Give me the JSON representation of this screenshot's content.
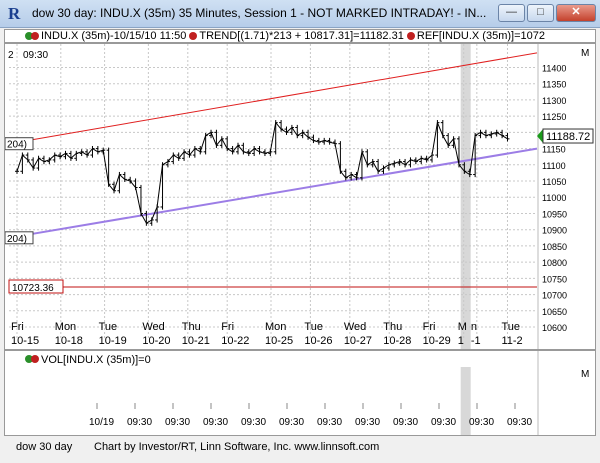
{
  "window": {
    "title": "dow 30 day: INDU.X (35m) 35 Minutes, Session 1 - NOT MARKED INTRADAY! - IN...",
    "minimize_label": "—",
    "maximize_label": "□",
    "close_label": "✕"
  },
  "legend": {
    "symbol": "INDU.X (35m)-10/15/10 11:50",
    "trend": "TREND[(1.71)*213 + 10817.31]=11182.31",
    "ref": "REF[INDU.X (35m)]=1072"
  },
  "top_pane": {
    "corner_number": "2",
    "corner_time": "09:30",
    "right_marker": "M",
    "price_tag": "11188.72",
    "trend_left_tag": "204)",
    "lower_left_tag": "204)",
    "ref_tag": "10723.36",
    "colors": {
      "trend_upper": "#e02020",
      "trend_lower": "#9c7de6",
      "ref": "#c01010",
      "price": "#000000",
      "highlight": "#d8d8d8"
    }
  },
  "chart_data": {
    "type": "line",
    "title": "",
    "ylim": [
      10560,
      11460
    ],
    "yticks": [
      11400,
      11350,
      11300,
      11250,
      11200,
      11150,
      11100,
      11050,
      11000,
      10950,
      10900,
      10850,
      10800,
      10750,
      10700,
      10650,
      10600
    ],
    "price_tag_value": 11188.72,
    "ref_value": 10723.36,
    "upper_trend": [
      [
        0,
        11165
      ],
      [
        100,
        11445
      ]
    ],
    "lower_trend": [
      [
        0,
        10875
      ],
      [
        100,
        11150
      ]
    ],
    "series": [
      {
        "values": [
          [
            0,
            11080
          ],
          [
            1,
            11130
          ],
          [
            2,
            11115
          ],
          [
            3,
            11090
          ],
          [
            4,
            11120
          ],
          [
            5,
            11110
          ],
          [
            6,
            11115
          ],
          [
            7,
            11130
          ],
          [
            8,
            11125
          ],
          [
            9,
            11135
          ],
          [
            10,
            11120
          ],
          [
            11,
            11135
          ],
          [
            12,
            11140
          ],
          [
            13,
            11130
          ],
          [
            14,
            11150
          ],
          [
            15,
            11140
          ],
          [
            16,
            11145
          ],
          [
            17,
            11040
          ],
          [
            18,
            11020
          ],
          [
            19,
            11070
          ],
          [
            20,
            11055
          ],
          [
            21,
            11050
          ],
          [
            22,
            11030
          ],
          [
            23,
            10950
          ],
          [
            24,
            10920
          ],
          [
            25,
            10930
          ],
          [
            26,
            10970
          ],
          [
            27,
            11100
          ],
          [
            28,
            11110
          ],
          [
            29,
            11130
          ],
          [
            30,
            11120
          ],
          [
            31,
            11140
          ],
          [
            32,
            11130
          ],
          [
            33,
            11150
          ],
          [
            34,
            11140
          ],
          [
            35,
            11190
          ],
          [
            36,
            11200
          ],
          [
            37,
            11160
          ],
          [
            38,
            11180
          ],
          [
            39,
            11150
          ],
          [
            40,
            11140
          ],
          [
            41,
            11160
          ],
          [
            42,
            11140
          ],
          [
            43,
            11135
          ],
          [
            44,
            11150
          ],
          [
            45,
            11140
          ],
          [
            46,
            11135
          ],
          [
            47,
            11140
          ],
          [
            48,
            11230
          ],
          [
            49,
            11210
          ],
          [
            50,
            11200
          ],
          [
            51,
            11215
          ],
          [
            52,
            11190
          ],
          [
            53,
            11200
          ],
          [
            54,
            11185
          ],
          [
            55,
            11175
          ],
          [
            56,
            11170
          ],
          [
            57,
            11175
          ],
          [
            58,
            11170
          ],
          [
            59,
            11165
          ],
          [
            60,
            11080
          ],
          [
            61,
            11060
          ],
          [
            62,
            11070
          ],
          [
            63,
            11060
          ],
          [
            64,
            11140
          ],
          [
            65,
            11100
          ],
          [
            66,
            11110
          ],
          [
            67,
            11080
          ],
          [
            68,
            11090
          ],
          [
            69,
            11100
          ],
          [
            70,
            11105
          ],
          [
            71,
            11110
          ],
          [
            72,
            11100
          ],
          [
            73,
            11115
          ],
          [
            74,
            11110
          ],
          [
            75,
            11120
          ],
          [
            76,
            11115
          ],
          [
            77,
            11130
          ],
          [
            78,
            11230
          ],
          [
            79,
            11190
          ],
          [
            80,
            11160
          ],
          [
            81,
            11180
          ],
          [
            82,
            11100
          ],
          [
            83,
            11080
          ],
          [
            84,
            11070
          ],
          [
            85,
            11190
          ],
          [
            86,
            11200
          ],
          [
            87,
            11190
          ],
          [
            88,
            11195
          ],
          [
            89,
            11200
          ],
          [
            90,
            11190
          ],
          [
            91,
            11180
          ]
        ]
      }
    ],
    "day_labels": [
      {
        "day": "Fri",
        "date": "10-15",
        "i": 0
      },
      {
        "day": "Mon",
        "date": "10-18",
        "i": 10
      },
      {
        "day": "Tue",
        "date": "10-19",
        "i": 20
      },
      {
        "day": "Wed",
        "date": "10-20",
        "i": 30
      },
      {
        "day": "Thu",
        "date": "10-21",
        "i": 39
      },
      {
        "day": "Fri",
        "date": "10-22",
        "i": 48
      },
      {
        "day": "Mon",
        "date": "10-25",
        "i": 58
      },
      {
        "day": "Tue",
        "date": "10-26",
        "i": 67
      },
      {
        "day": "Wed",
        "date": "10-27",
        "i": 76
      },
      {
        "day": "Thu",
        "date": "10-28",
        "i": 85
      },
      {
        "day": "Fri",
        "date": "10-29",
        "i": 94
      },
      {
        "day": "M",
        "date": "1",
        "i": 102
      },
      {
        "day": "n",
        "date": "-1",
        "i": 105
      },
      {
        "day": "Tue",
        "date": "11-2",
        "i": 112
      }
    ]
  },
  "vol_pane": {
    "label": "VOL[INDU.X (35m)]=0",
    "right_marker": "M",
    "time_labels": [
      "10/19",
      "09:30",
      "09:30",
      "09:30",
      "09:30",
      "09:30",
      "09:30",
      "09:30",
      "09:30",
      "09:30",
      "09:30",
      "09:30"
    ]
  },
  "status": {
    "left": "dow 30 day",
    "credit": "Chart by Investor/RT, Linn Software, Inc. www.linnsoft.com"
  }
}
